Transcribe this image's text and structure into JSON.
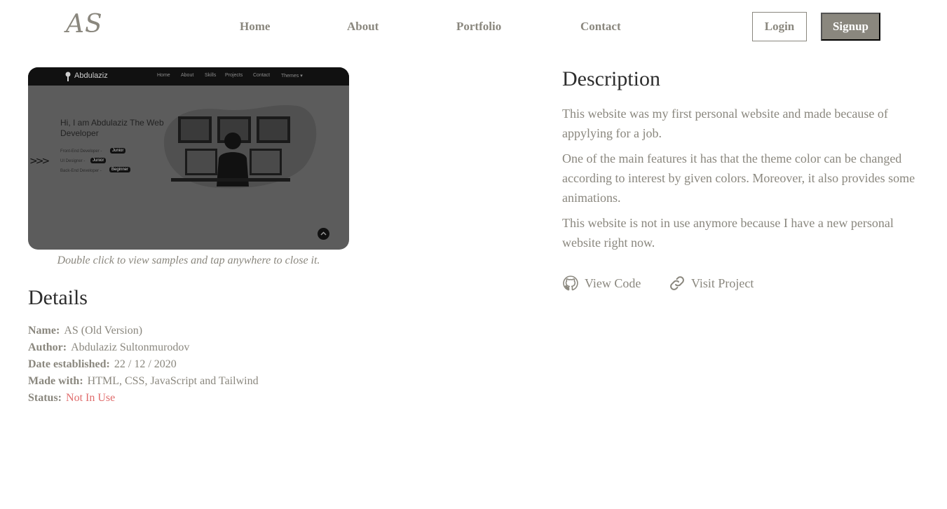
{
  "nav": {
    "logo": "AS",
    "links": [
      "Home",
      "About",
      "Portfolio",
      "Contact"
    ],
    "login": "Login",
    "signup": "Signup"
  },
  "preview": {
    "brand": "Abdulaziz",
    "menu": [
      "Home",
      "About",
      "Skills",
      "Projects",
      "Contact",
      "Themes ▾"
    ],
    "hero_title": "Hi, I am Abdulaziz The Web Developer",
    "skills": [
      {
        "label": "Front-End Developer -",
        "level": "Junior"
      },
      {
        "label": "UI Designer -",
        "level": "Junior"
      },
      {
        "label": "Back-End Developer -",
        "level": "Beginner"
      }
    ],
    "arrows": ">>>"
  },
  "caption": "Double click to view samples and tap anywhere to close it.",
  "details": {
    "heading": "Details",
    "rows": [
      {
        "key": "Name:",
        "value": "AS (Old Version)"
      },
      {
        "key": "Author:",
        "value": "Abdulaziz Sultonmurodov"
      },
      {
        "key": "Date established:",
        "value": "22 / 12 / 2020"
      },
      {
        "key": "Made with:",
        "value": "HTML, CSS, JavaScript and Tailwind"
      },
      {
        "key": "Status:",
        "value": "Not In Use"
      }
    ]
  },
  "description": {
    "heading": "Description",
    "paragraphs": [
      "This website was my first personal website and made because of appylying for a job.",
      "One of the main features it has that the theme color can be changed according to interest by given colors. Moreover, it also provides some animations.",
      "This website is not in use anymore because I have a new personal website right now."
    ]
  },
  "links": {
    "view_code": "View Code",
    "visit_project": "Visit Project"
  },
  "colors": {
    "primary": "#8a877e",
    "heading": "#2d2d2d",
    "status_inactive": "#e06c6c",
    "background": "#ffffff"
  },
  "icons": [
    "github-icon",
    "link-icon",
    "arrow-up-icon"
  ]
}
